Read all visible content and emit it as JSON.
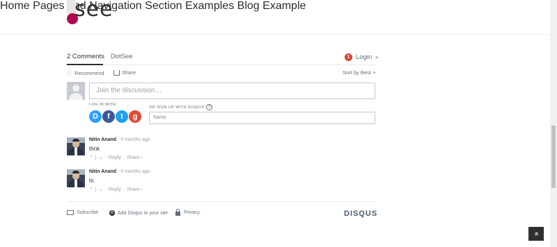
{
  "site": {
    "logo_text": "see",
    "nav": [
      "Home",
      "Pages and Navigation",
      "Section Examples",
      "Blog Example"
    ]
  },
  "disqus": {
    "tabs": [
      "2 Comments",
      "DotSee"
    ],
    "login_badge": "1",
    "login_label": "Login",
    "recommend_label": "Recommend",
    "share_label": "Share",
    "sort_label": "Sort by Best",
    "join_placeholder": "Join the discussion…",
    "login_with_label": "LOG IN WITH",
    "signup_label": "OR SIGN UP WITH DISQUS",
    "help_glyph": "?",
    "social": [
      {
        "letter": "D",
        "color": "#2e9fff"
      },
      {
        "letter": "f",
        "color": "#3b5998"
      },
      {
        "letter": "t",
        "color": "#1da1f2"
      },
      {
        "letter": "g",
        "color": "#dd4b39"
      }
    ],
    "name_placeholder": "Name",
    "comments": [
      {
        "author": "Nitin Anand",
        "time": "· 5 months ago",
        "text": "thnk",
        "reply": "Reply",
        "share": "Share ›"
      },
      {
        "author": "Nitin Anand",
        "time": "· 5 months ago",
        "text": "hi",
        "reply": "Reply",
        "share": "Share ›"
      }
    ],
    "footer": {
      "subscribe": "Subscribe",
      "add_disqus": "Add Disqus to your site",
      "privacy": "Privacy",
      "brand": "DISQUS"
    }
  },
  "back_to_top_icon": "double-chevron-up-icon",
  "colors": {
    "accent": "#b5094f",
    "login_badge": "#db4437",
    "recommend_heart": "#e0504a"
  }
}
